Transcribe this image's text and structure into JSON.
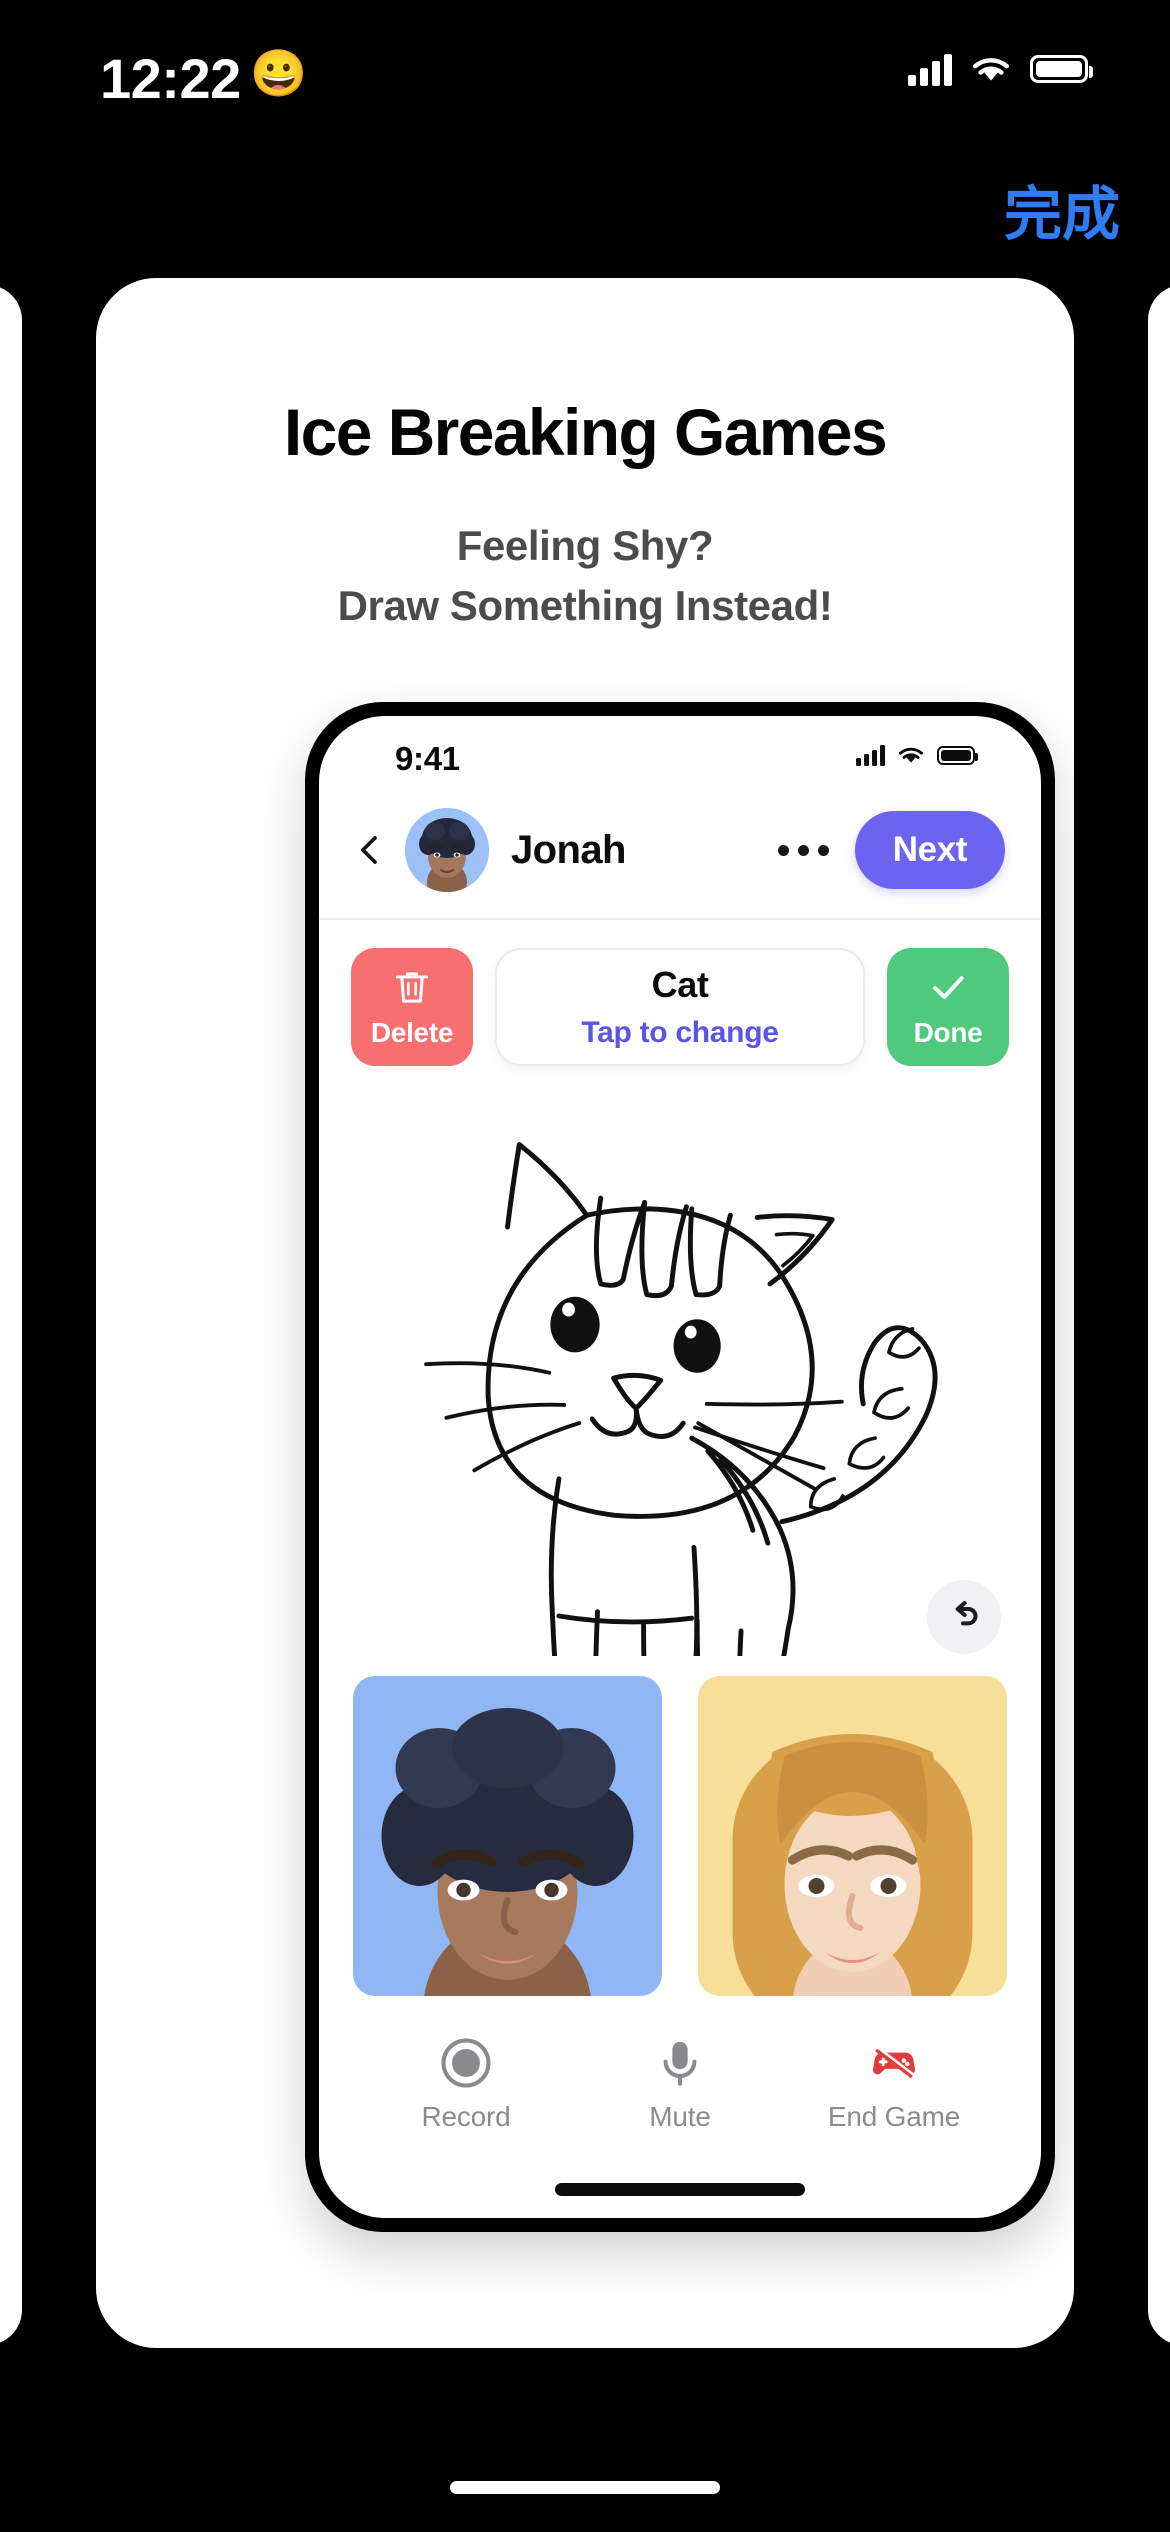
{
  "os_status_bar": {
    "time": "12:22",
    "emoji": "😀",
    "icons": [
      "cellular-signal-icon",
      "wifi-icon",
      "battery-icon"
    ]
  },
  "os_nav": {
    "done_label": "完成"
  },
  "card": {
    "title": "Ice Breaking Games",
    "subtitle_line1": "Feeling Shy?",
    "subtitle_line2": "Draw Something Instead!"
  },
  "phone": {
    "status_bar": {
      "time": "9:41",
      "icons": [
        "cellular-signal-icon",
        "wifi-icon",
        "battery-icon"
      ]
    },
    "header": {
      "back_icon": "chevron-left-icon",
      "avatar": "avatar-jonah",
      "peer_name": "Jonah",
      "more_icon": "ellipsis-icon",
      "next_label": "Next"
    },
    "toolbar": {
      "delete_label": "Delete",
      "delete_icon": "trash-icon",
      "word": "Cat",
      "hint": "Tap to change",
      "done_label": "Done",
      "done_icon": "check-icon"
    },
    "canvas": {
      "drawing": "cat-doodle",
      "undo_icon": "undo-arrow-icon"
    },
    "tiles": [
      {
        "name": "avatar-tile-jonah",
        "background": "#91b6f5"
      },
      {
        "name": "avatar-tile-partner",
        "background": "#f7df9a"
      }
    ],
    "controls": [
      {
        "label": "Record",
        "icon": "record-circle-icon"
      },
      {
        "label": "Mute",
        "icon": "microphone-icon"
      },
      {
        "label": "End Game",
        "icon": "gamepad-slash-icon"
      }
    ]
  },
  "colors": {
    "accent_purple": "#6c63f0",
    "delete_red": "#f86f6f",
    "done_green": "#4ec97e",
    "link_blue": "#2f7cf6",
    "hint_violet": "#5b55e6",
    "end_game_red": "#e23b3b"
  }
}
